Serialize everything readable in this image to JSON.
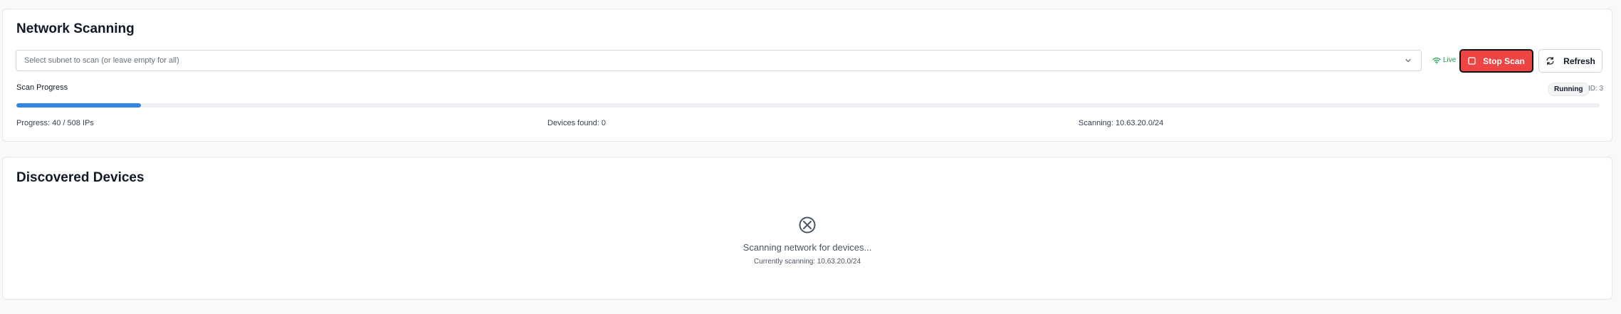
{
  "scan_card": {
    "title": "Network Scanning",
    "subnet_placeholder": "Select subnet to scan (or leave empty for all)",
    "live_label": "Live",
    "stop_label": "Stop Scan",
    "refresh_label": "Refresh",
    "progress_label": "Scan Progress",
    "status": "Running",
    "scan_id": "ID: 3",
    "progress_fraction": 0.0787,
    "stats": {
      "progress": "Progress: 40 / 508 IPs",
      "devices_found": "Devices found: 0",
      "scanning": "Scanning: 10.63.20.0/24"
    }
  },
  "devices_card": {
    "title": "Discovered Devices",
    "empty_title": "Scanning network for devices...",
    "empty_sub": "Currently scanning: 10.63.20.0/24"
  },
  "icons": {
    "live": "wifi-icon",
    "stop": "stop-square-icon",
    "refresh": "refresh-icon",
    "empty": "circle-x-icon",
    "select": "chevron-down-icon"
  },
  "colors": {
    "accent": "#2f86e6",
    "danger": "#ef4444",
    "live": "#16a34a"
  }
}
